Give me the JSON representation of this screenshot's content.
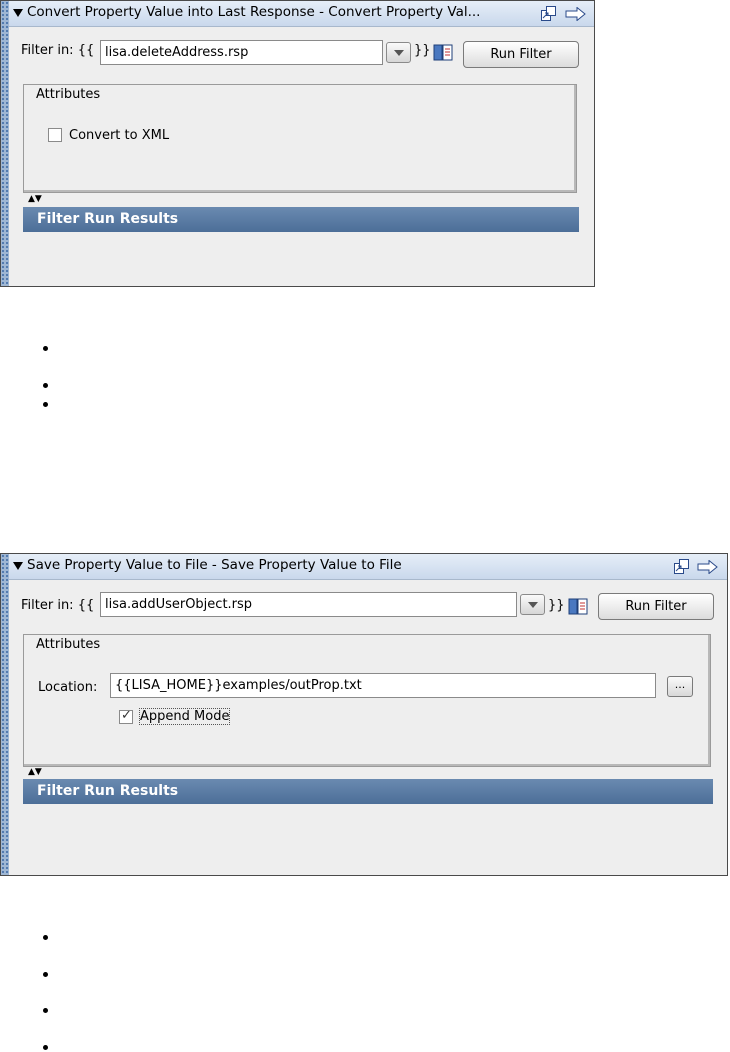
{
  "panel1": {
    "title": "Convert Property Value into Last Response - Convert Property Val...",
    "filter_label": "Filter in: {{",
    "filter_value": "lisa.deleteAddress.rsp",
    "close_brace": "}}",
    "run_filter_label": "Run Filter",
    "attributes_title": "Attributes",
    "checkbox_label": "Convert to XML",
    "checkbox_checked": false,
    "results_title": "Filter Run Results"
  },
  "panel2": {
    "title": "Save Property Value to File - Save Property Value to File",
    "filter_label": "Filter in: {{",
    "filter_value": "lisa.addUserObject.rsp",
    "close_brace": "}}",
    "run_filter_label": "Run Filter",
    "attributes_title": "Attributes",
    "location_label": "Location:",
    "location_value": "{{LISA_HOME}}examples/outProp.txt",
    "browse_label": "...",
    "checkbox_label": "Append Mode",
    "checkbox_checked": true,
    "results_title": "Filter Run Results"
  },
  "icons": {
    "collapse": "triangle-down-icon",
    "dock": "undock-window-icon",
    "arrow": "right-arrow-icon",
    "book": "property-book-icon",
    "combo": "dropdown-arrow-icon"
  },
  "colors": {
    "titlebar": "#c9d8ec",
    "results_header": "#4c6e98",
    "stripe": "#9fb7d4"
  }
}
